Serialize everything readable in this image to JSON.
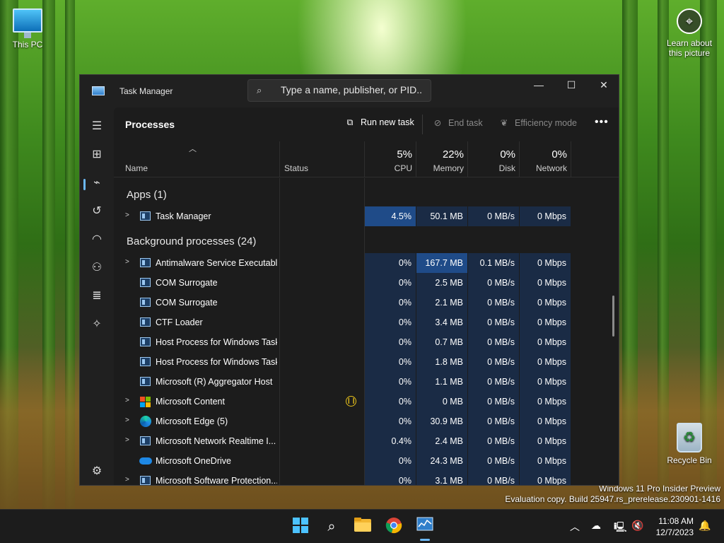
{
  "desktop": {
    "this_pc": "This PC",
    "recycle_bin": "Recycle Bin",
    "learn": "Learn about this picture",
    "watermark_line1": "Windows 11 Pro Insider Preview",
    "watermark_line2": "Evaluation copy. Build 25947.rs_prerelease.230901-1416"
  },
  "window": {
    "title": "Task Manager",
    "search_placeholder": "Type a name, publisher, or PID..."
  },
  "toolbar": {
    "heading": "Processes",
    "run_new_task": "Run new task",
    "end_task": "End task",
    "efficiency_mode": "Efficiency mode"
  },
  "columns": {
    "name": "Name",
    "status": "Status",
    "cpu_pct": "5%",
    "cpu": "CPU",
    "memory_pct": "22%",
    "memory": "Memory",
    "disk_pct": "0%",
    "disk": "Disk",
    "network_pct": "0%",
    "network": "Network"
  },
  "groups": {
    "apps": "Apps (1)",
    "background": "Background processes (24)"
  },
  "apps": [
    {
      "name": "Task Manager",
      "cpu": "4.5%",
      "memory": "50.1 MB",
      "disk": "0 MB/s",
      "network": "0 Mbps"
    }
  ],
  "background": [
    {
      "name": "Antimalware Service Executable",
      "cpu": "0%",
      "memory": "167.7 MB",
      "disk": "0.1 MB/s",
      "network": "0 Mbps"
    },
    {
      "name": "COM Surrogate",
      "cpu": "0%",
      "memory": "2.5 MB",
      "disk": "0 MB/s",
      "network": "0 Mbps"
    },
    {
      "name": "COM Surrogate",
      "cpu": "0%",
      "memory": "2.1 MB",
      "disk": "0 MB/s",
      "network": "0 Mbps"
    },
    {
      "name": "CTF Loader",
      "cpu": "0%",
      "memory": "3.4 MB",
      "disk": "0 MB/s",
      "network": "0 Mbps"
    },
    {
      "name": "Host Process for Windows Tasks",
      "cpu": "0%",
      "memory": "0.7 MB",
      "disk": "0 MB/s",
      "network": "0 Mbps"
    },
    {
      "name": "Host Process for Windows Tasks",
      "cpu": "0%",
      "memory": "1.8 MB",
      "disk": "0 MB/s",
      "network": "0 Mbps"
    },
    {
      "name": "Microsoft (R) Aggregator Host",
      "cpu": "0%",
      "memory": "1.1 MB",
      "disk": "0 MB/s",
      "network": "0 Mbps"
    },
    {
      "name": "Microsoft Content",
      "cpu": "0%",
      "memory": "0 MB",
      "disk": "0 MB/s",
      "network": "0 Mbps"
    },
    {
      "name": "Microsoft Edge (5)",
      "cpu": "0%",
      "memory": "30.9 MB",
      "disk": "0 MB/s",
      "network": "0 Mbps"
    },
    {
      "name": "Microsoft Network Realtime I...",
      "cpu": "0.4%",
      "memory": "2.4 MB",
      "disk": "0 MB/s",
      "network": "0 Mbps"
    },
    {
      "name": "Microsoft OneDrive",
      "cpu": "0%",
      "memory": "24.3 MB",
      "disk": "0 MB/s",
      "network": "0 Mbps"
    },
    {
      "name": "Microsoft Software Protection...",
      "cpu": "0%",
      "memory": "3.1 MB",
      "disk": "0 MB/s",
      "network": "0 Mbps"
    }
  ],
  "taskbar": {
    "time": "11:08 AM",
    "date": "12/7/2023"
  }
}
